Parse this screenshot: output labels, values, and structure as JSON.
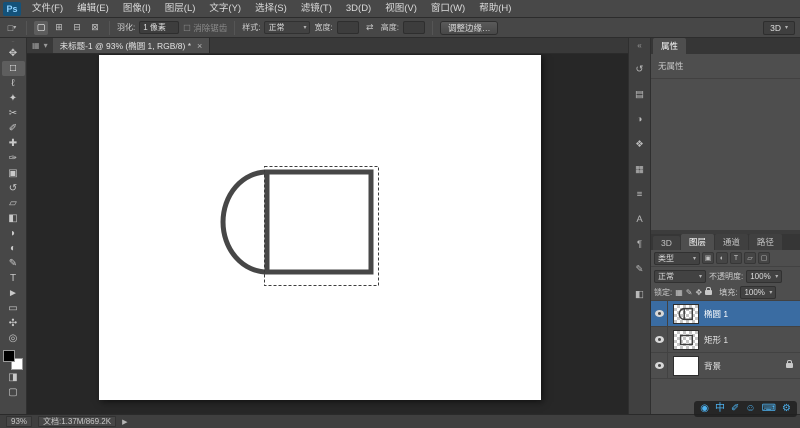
{
  "colors": {
    "selection_blue": "#3a6ca2",
    "ime_blue": "#4db2f0",
    "shape_stroke": "#474747",
    "canvas_white": "#ffffff"
  },
  "app": {
    "logo": "Ps"
  },
  "ui": {
    "caret": "▾",
    "checkbox": "☐",
    "grip": "∙∙",
    "tab_grip1": "▦",
    "tab_grip2": "▾"
  },
  "menubar": {
    "items": [
      {
        "label": "文件(F)"
      },
      {
        "label": "编辑(E)"
      },
      {
        "label": "图像(I)"
      },
      {
        "label": "图层(L)"
      },
      {
        "label": "文字(Y)"
      },
      {
        "label": "选择(S)"
      },
      {
        "label": "滤镜(T)"
      },
      {
        "label": "3D(D)"
      },
      {
        "label": "视图(V)"
      },
      {
        "label": "窗口(W)"
      },
      {
        "label": "帮助(H)"
      }
    ]
  },
  "options_bar": {
    "preset_glyph": "□",
    "boolean_icons": [
      {
        "name": "new-selection",
        "glyph": "▢"
      },
      {
        "name": "add-to-selection",
        "glyph": "⊞"
      },
      {
        "name": "subtract-from-selection",
        "glyph": "⊟"
      },
      {
        "name": "intersect-selection",
        "glyph": "⊠"
      }
    ],
    "feather_label": "羽化:",
    "feather_value": "1 像素",
    "antialias_label": "消除锯齿",
    "style_label": "样式:",
    "style_value": "正常",
    "width_label": "宽度:",
    "swap_icon": "⇄",
    "height_label": "高度:",
    "refine_edge_label": "调整边缘…",
    "workspace_label": "3D"
  },
  "tab_bar": {
    "doc_title": "未标题-1 @ 93% (椭圆 1, RGB/8) *",
    "close_glyph": "×"
  },
  "toolbar": {
    "tools": [
      {
        "name": "move-tool",
        "glyph": "✥"
      },
      {
        "name": "rectangular-marquee-tool",
        "glyph": "□",
        "selected": true
      },
      {
        "name": "lasso-tool",
        "glyph": "ℓ"
      },
      {
        "name": "quick-selection-tool",
        "glyph": "✦"
      },
      {
        "name": "crop-tool",
        "glyph": "✂"
      },
      {
        "name": "eyedropper-tool",
        "glyph": "✐"
      },
      {
        "name": "healing-brush-tool",
        "glyph": "✚"
      },
      {
        "name": "brush-tool",
        "glyph": "✑"
      },
      {
        "name": "clone-stamp-tool",
        "glyph": "▣"
      },
      {
        "name": "history-brush-tool",
        "glyph": "↺"
      },
      {
        "name": "eraser-tool",
        "glyph": "▱"
      },
      {
        "name": "gradient-tool",
        "glyph": "◧"
      },
      {
        "name": "blur-tool",
        "glyph": "◗"
      },
      {
        "name": "dodge-tool",
        "glyph": "◐"
      },
      {
        "name": "pen-tool",
        "glyph": "✎"
      },
      {
        "name": "type-tool",
        "glyph": "T"
      },
      {
        "name": "path-selection-tool",
        "glyph": "►"
      },
      {
        "name": "shape-tool",
        "glyph": "▭"
      },
      {
        "name": "hand-tool",
        "glyph": "✣"
      },
      {
        "name": "zoom-tool",
        "glyph": "◎"
      }
    ],
    "quick_mask_glyph": "◨",
    "screen_mode_glyph": "▢"
  },
  "dock": {
    "collapse_glyph": "«",
    "icons": [
      {
        "name": "history-panel-icon",
        "glyph": "↺"
      },
      {
        "name": "color-panel-icon",
        "glyph": "▤"
      },
      {
        "name": "adjustments-panel-icon",
        "glyph": "◑"
      },
      {
        "name": "styles-panel-icon",
        "glyph": "❖"
      },
      {
        "name": "info-panel-icon",
        "glyph": "▦"
      },
      {
        "name": "navigator-panel-icon",
        "glyph": "≡"
      },
      {
        "name": "character-panel-icon",
        "glyph": "A"
      },
      {
        "name": "paragraph-panel-icon",
        "glyph": "¶"
      },
      {
        "name": "brush-panel-icon",
        "glyph": "✎"
      },
      {
        "name": "clone-source-panel-icon",
        "glyph": "◧"
      }
    ]
  },
  "properties_panel": {
    "tab_label": "属性",
    "empty_text": "无属性"
  },
  "layers_panel": {
    "tabs": [
      {
        "label": "3D"
      },
      {
        "label": "图层",
        "active": true
      },
      {
        "label": "通道"
      },
      {
        "label": "路径"
      }
    ],
    "filter_label": "类型",
    "filter_icons": [
      {
        "name": "filter-pixel-layers-icon",
        "glyph": "▣"
      },
      {
        "name": "filter-adjustment-layers-icon",
        "glyph": "◐"
      },
      {
        "name": "filter-type-layers-icon",
        "glyph": "T"
      },
      {
        "name": "filter-shape-layers-icon",
        "glyph": "▱"
      },
      {
        "name": "filter-smart-objects-icon",
        "glyph": "▢"
      }
    ],
    "blend_mode": "正常",
    "opacity_label": "不透明度:",
    "opacity_value": "100%",
    "lock_label": "锁定:",
    "lock_icons": [
      {
        "name": "lock-transparency-icon",
        "glyph": "▦"
      },
      {
        "name": "lock-pixels-icon",
        "glyph": "✎"
      },
      {
        "name": "lock-position-icon",
        "glyph": "✥"
      }
    ],
    "fill_label": "填充:",
    "fill_value": "100%",
    "layers": [
      {
        "name": "椭圆 1",
        "selected": true
      },
      {
        "name": "矩形 1",
        "selected": false
      },
      {
        "name": "背景",
        "selected": false,
        "locked": true
      }
    ]
  },
  "status_bar": {
    "zoom": "93%",
    "doc_info": "文档:1.37M/869.2K",
    "expand_glyph": "▶"
  },
  "ime_bar": {
    "icons": [
      {
        "name": "ime-logo-icon",
        "glyph": "◉"
      },
      {
        "name": "ime-chinese-mode-icon",
        "glyph": "中"
      },
      {
        "name": "ime-punctuation-icon",
        "glyph": "✐"
      },
      {
        "name": "ime-emoticon-icon",
        "glyph": "☺"
      },
      {
        "name": "ime-keyboard-icon",
        "glyph": "⌨"
      },
      {
        "name": "ime-settings-icon",
        "glyph": "⚙"
      }
    ]
  }
}
